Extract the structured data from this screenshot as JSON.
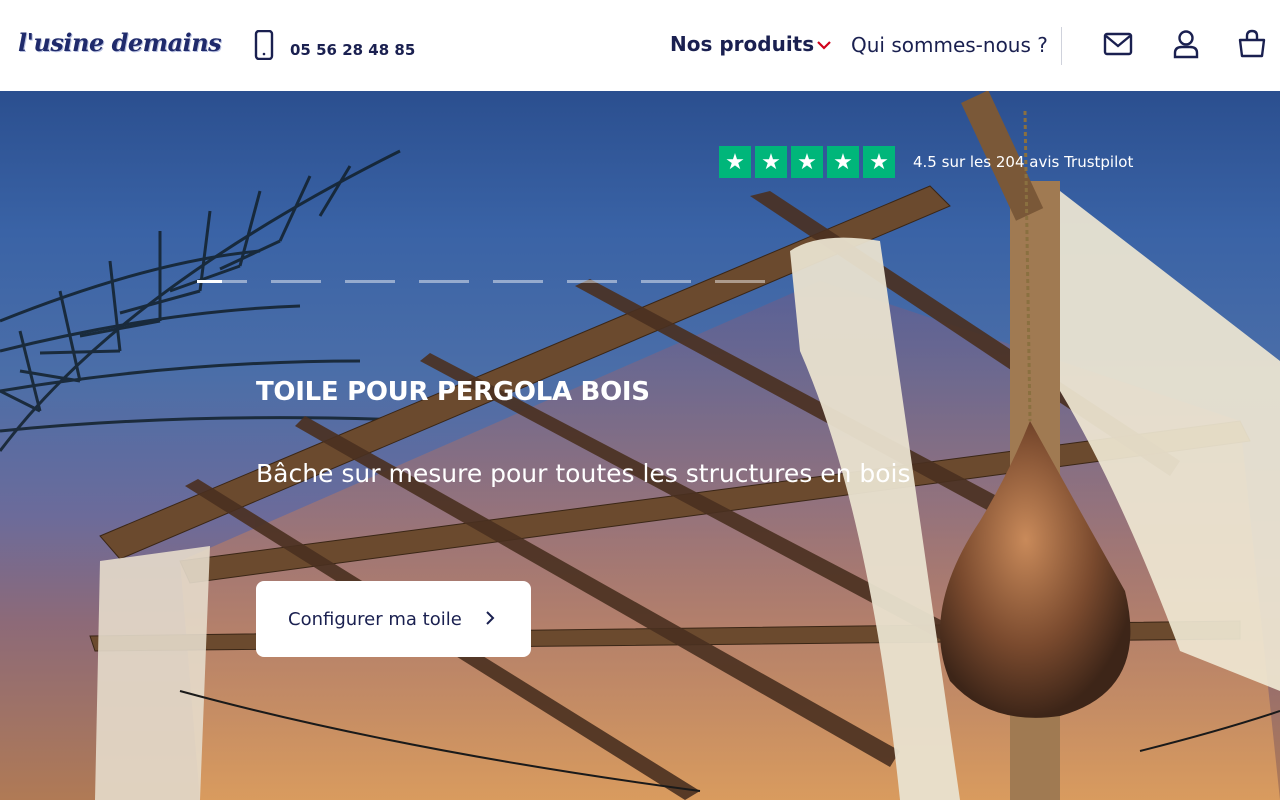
{
  "header": {
    "logo": "l'usine demains",
    "phone_icon": "smartphone-icon",
    "phone": "05 56 28 48 85",
    "nav": {
      "produits": "Nos produits",
      "qui": "Qui sommes-nous ?"
    },
    "icons": [
      "mail-icon",
      "user-icon",
      "shopping-bag-icon"
    ],
    "accent_color": "#d0021b"
  },
  "hero": {
    "trustpilot": {
      "stars": 5,
      "star_color": "#00b67a",
      "text": "4.5 sur les 204 avis Trustpilot"
    },
    "slides_count": 8,
    "active_slide": 1,
    "title": "TOILE POUR PERGOLA BOIS",
    "subtitle": "Bâche sur mesure pour toutes les structures en bois",
    "cta_label": "Configurer ma toile"
  }
}
